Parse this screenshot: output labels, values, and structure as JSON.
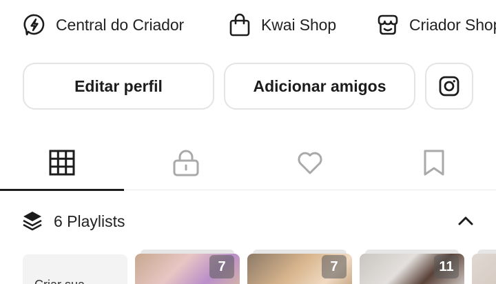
{
  "shortcuts": [
    {
      "label": "Central do Criador",
      "icon": "lightning-bolt-icon"
    },
    {
      "label": "Kwai Shop",
      "icon": "shopping-bag-icon"
    },
    {
      "label": "Criador Shop",
      "icon": "storefront-icon"
    }
  ],
  "buttons": {
    "edit_profile": "Editar perfil",
    "add_friends": "Adicionar amigos",
    "instagram_icon": "instagram-icon"
  },
  "tabs": [
    {
      "icon": "grid-icon",
      "selected": true
    },
    {
      "icon": "lock-icon",
      "selected": false
    },
    {
      "icon": "heart-icon",
      "selected": false
    },
    {
      "icon": "bookmark-icon",
      "selected": false
    }
  ],
  "playlists": {
    "title": "6 Playlists",
    "collapse_icon": "chevron-up-icon",
    "create_label": "Criar sua",
    "cards": [
      {
        "count": "7"
      },
      {
        "count": "7"
      },
      {
        "count": "11"
      },
      {
        "count": ""
      }
    ]
  },
  "colors": {
    "text": "#222222",
    "border": "#e4e4e4",
    "indicator": "#1c1c1c",
    "create_card_bg": "#f3f3f3"
  }
}
